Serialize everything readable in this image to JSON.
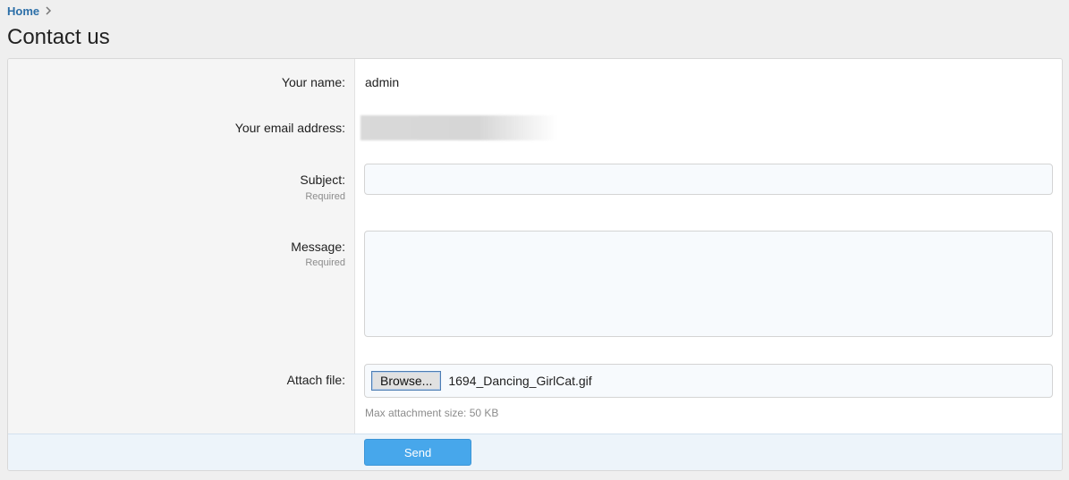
{
  "breadcrumb": {
    "home_label": "Home"
  },
  "page": {
    "title": "Contact us"
  },
  "form": {
    "name_label": "Your name:",
    "name_value": "admin",
    "email_label": "Your email address:",
    "subject_label": "Subject:",
    "subject_hint": "Required",
    "subject_value": "",
    "message_label": "Message:",
    "message_hint": "Required",
    "message_value": "",
    "attach_label": "Attach file:",
    "browse_label": "Browse...",
    "file_name": "1694_Dancing_GirlCat.gif",
    "attach_help": "Max attachment size: 50 KB",
    "send_label": "Send"
  },
  "colors": {
    "link": "#2c6fa8",
    "send_button": "#47a7eb",
    "submit_row": "#edf4fa"
  },
  "icons": {
    "breadcrumb_separator": "chevron-right-icon"
  }
}
